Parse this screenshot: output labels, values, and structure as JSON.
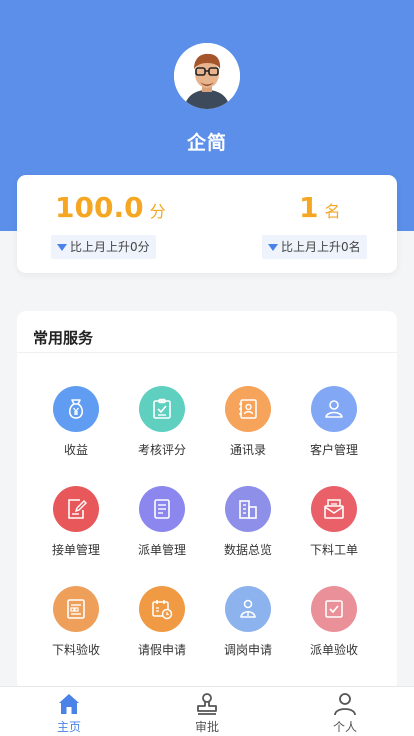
{
  "profile": {
    "name": "企简"
  },
  "score": {
    "value": "100.0",
    "unit": "分",
    "delta": "比上月上升0分"
  },
  "rank": {
    "value": "1",
    "unit": "名",
    "delta": "比上月上升0名"
  },
  "services": {
    "title": "常用服务",
    "items": [
      {
        "label": "收益",
        "icon": "money-bag-icon",
        "color": "#5f9cf2"
      },
      {
        "label": "考核评分",
        "icon": "clipboard-check-icon",
        "color": "#5fcfbf"
      },
      {
        "label": "通讯录",
        "icon": "contact-book-icon",
        "color": "#f6a35b"
      },
      {
        "label": "客户管理",
        "icon": "customer-icon",
        "color": "#82a8f5"
      },
      {
        "label": "接单管理",
        "icon": "edit-note-icon",
        "color": "#e8585a"
      },
      {
        "label": "派单管理",
        "icon": "document-list-icon",
        "color": "#8c86ef"
      },
      {
        "label": "数据总览",
        "icon": "buildings-icon",
        "color": "#8d8fe8"
      },
      {
        "label": "下料工单",
        "icon": "mail-tray-icon",
        "color": "#ea6068"
      },
      {
        "label": "下料验收",
        "icon": "form-icon",
        "color": "#eea05a"
      },
      {
        "label": "请假申请",
        "icon": "calendar-clock-icon",
        "color": "#f09a43"
      },
      {
        "label": "调岗申请",
        "icon": "person-transfer-icon",
        "color": "#8db3ee"
      },
      {
        "label": "派单验收",
        "icon": "check-box-icon",
        "color": "#ea9098"
      }
    ]
  },
  "tabbar": {
    "items": [
      {
        "label": "主页",
        "icon": "home-icon",
        "active": true
      },
      {
        "label": "审批",
        "icon": "stamp-icon",
        "active": false
      },
      {
        "label": "个人",
        "icon": "person-icon",
        "active": false
      }
    ],
    "active_color": "#4a82e8",
    "inactive_color": "#555555"
  },
  "colors": {
    "header": "#5b8fea",
    "accent": "#f5a623"
  }
}
